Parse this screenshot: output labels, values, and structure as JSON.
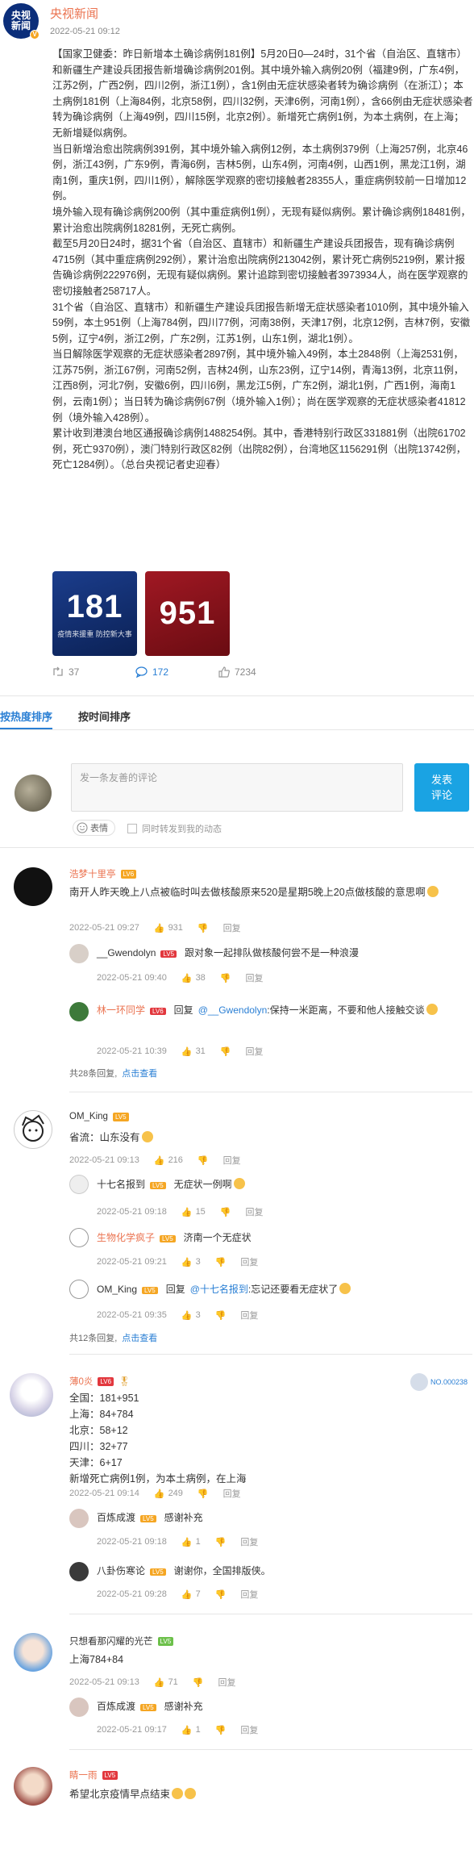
{
  "post": {
    "avatar_line1": "央视",
    "avatar_line2": "新闻",
    "author": "央视新闻",
    "time": "2022-05-21 09:12",
    "body": "【国家卫健委：昨日新增本土确诊病例181例】5月20日0—24时，31个省（自治区、直辖市）和新疆生产建设兵团报告新增确诊病例201例。其中境外输入病例20例（福建9例，广东4例，江苏2例，广西2例，四川2例，浙江1例），含1例由无症状感染者转为确诊病例（在浙江）；本土病例181例（上海84例，北京58例，四川32例，天津6例，河南1例），含66例由无症状感染者转为确诊病例（上海49例，四川15例，北京2例）。新增死亡病例1例，为本土病例，在上海；无新增疑似病例。\n当日新增治愈出院病例391例，其中境外输入病例12例，本土病例379例（上海257例，北京46例，浙江43例，广东9例，青海6例，吉林5例，山东4例，河南4例，山西1例，黑龙江1例，湖南1例，重庆1例，四川1例），解除医学观察的密切接触者28355人，重症病例较前一日增加12例。\n境外输入现有确诊病例200例（其中重症病例1例），无现有疑似病例。累计确诊病例18481例，累计治愈出院病例18281例，无死亡病例。\n截至5月20日24时，据31个省（自治区、直辖市）和新疆生产建设兵团报告，现有确诊病例4715例（其中重症病例292例），累计治愈出院病例213042例，累计死亡病例5219例，累计报告确诊病例222976例，无现有疑似病例。累计追踪到密切接触者3973934人，尚在医学观察的密切接触者258717人。\n31个省（自治区、直辖市）和新疆生产建设兵团报告新增无症状感染者1010例，其中境外输入59例，本土951例（上海784例，四川77例，河南38例，天津17例，北京12例，吉林7例，安徽5例，辽宁4例，浙江2例，广东2例，江苏1例，山东1例，湖北1例）。\n当日解除医学观察的无症状感染者2897例，其中境外输入49例，本土2848例（上海2531例，江苏75例，浙江67例，河南52例，吉林24例，山东23例，辽宁14例，青海13例，北京11例，江西8例，河北7例，安徽6例，四川6例，黑龙江5例，广东2例，湖北1例，广西1例，海南1例，云南1例）；当日转为确诊病例67例（境外输入1例）；尚在医学观察的无症状感染者41812例（境外输入428例）。\n累计收到港澳台地区通报确诊病例1488254例。其中，香港特别行政区331881例（出院61702例，死亡9370例），澳门特别行政区82例（出院82例），台湾地区1156291例（出院13742例，死亡1284例）。（总台央视记者史迎春）",
    "image1_number": "181",
    "image1_caption": "疫情来援重 防控新大事",
    "image2_number": "951",
    "reposts": "37",
    "comments": "172",
    "likes": "7234"
  },
  "sort_tabs": [
    "按热度排序",
    "按时间排序"
  ],
  "composer": {
    "placeholder": "发一条友善的评论",
    "send_label": "发表\n评论",
    "emoji_label": "表情",
    "repost_label": "同时转发到我的动态"
  },
  "reply_label": "回复",
  "comments": [
    {
      "name": "浩梦十里亭",
      "level": "LV6",
      "text": "南开人昨天晚上八点被临时叫去做核酸原来520是星期5晚上20点做核酸的意思啊",
      "time": "2022-05-21 09:27",
      "likes": "931",
      "subs": [
        {
          "name": "__Gwendolyn",
          "level": "LV5",
          "text": "跟对象一起排队做核酸何尝不是一种浪漫",
          "time": "2022-05-21 09:40",
          "likes": "38"
        },
        {
          "name": "林一环同学",
          "level": "LV6",
          "prefix": "回复",
          "at": "@__Gwendolyn",
          "text": ":保持一米距离，不要和他人接触交谈",
          "time": "2022-05-21 10:39",
          "likes": "31"
        }
      ],
      "more": "共28条回复,",
      "more_link": "点击查看"
    },
    {
      "name": "OM_King",
      "level": "LV5",
      "text": "省流：山东没有",
      "time": "2022-05-21 09:13",
      "likes": "216",
      "subs": [
        {
          "name": "十七名报到",
          "level": "LV5",
          "text": "无症状一例啊",
          "time": "2022-05-21 09:18",
          "likes": "15"
        },
        {
          "name": "生物化学疯子",
          "level": "LV5",
          "text": "济南一个无症状",
          "time": "2022-05-21 09:21",
          "likes": "3"
        },
        {
          "name": "OM_King",
          "level": "LV5",
          "prefix": "回复",
          "at": "@十七名报到",
          "text": ":忘记还要看无症状了",
          "time": "2022-05-21 09:35",
          "likes": "3"
        }
      ],
      "more": "共12条回复,",
      "more_link": "点击查看"
    },
    {
      "name": "薄0炎",
      "level": "LV6",
      "badge": "NO.000238",
      "text": "全国：181+951\n上海：84+784\n北京：58+12\n四川：32+77\n天津：6+17\n新增死亡病例1例，为本土病例，在上海",
      "time": "2022-05-21 09:14",
      "likes": "249",
      "subs": [
        {
          "name": "百炼成渡",
          "level": "LV5",
          "text": "感谢补充",
          "time": "2022-05-21 09:18",
          "likes": "1"
        },
        {
          "name": "八卦伤寒论",
          "level": "LV5",
          "text": "谢谢你，全国排版侠。",
          "time": "2022-05-21 09:28",
          "likes": "7"
        }
      ]
    },
    {
      "name": "只想看那闪耀的光芒",
      "level": "LV5",
      "text": "上海784+84",
      "time": "2022-05-21 09:13",
      "likes": "71",
      "subs": [
        {
          "name": "百炼成渡",
          "level": "LV5",
          "text": "感谢补充",
          "time": "2022-05-21 09:17",
          "likes": "1"
        }
      ]
    },
    {
      "name": "睛一雨",
      "level": "LV5",
      "text": "希望北京疫情早点结束"
    }
  ],
  "colors": {
    "accent": "#2a7fd4",
    "name": "#eb7350",
    "send": "#1aa3e3"
  }
}
